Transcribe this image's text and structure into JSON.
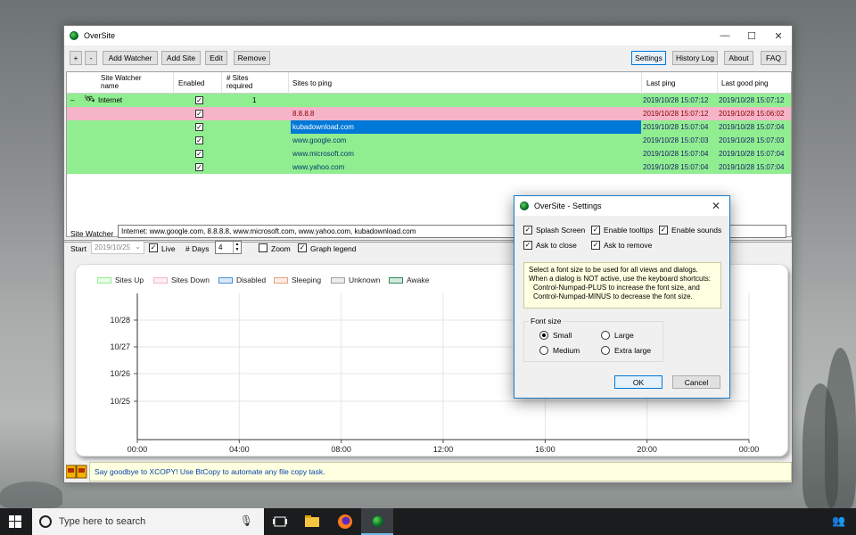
{
  "main_window": {
    "title": "OverSite",
    "controls": {
      "minimize": "—",
      "maximize": "☐",
      "close": "✕"
    }
  },
  "toolbar": {
    "plus": "+",
    "minus": "-",
    "add_watcher": "Add Watcher",
    "add_site": "Add Site",
    "edit": "Edit",
    "remove": "Remove",
    "settings": "Settings",
    "history_log": "History Log",
    "about": "About",
    "faq": "FAQ"
  },
  "grid": {
    "columns": [
      "Site Watcher name",
      "Enabled",
      "# Sites required",
      "Sites to ping",
      "Last ping",
      "Last good ping"
    ],
    "watcher": {
      "expander": "–",
      "name": "Internet",
      "required": "1",
      "last_ping": "2019/10/28 15:07:12",
      "last_good_ping": "2019/10/28 15:07:12"
    },
    "sites": [
      {
        "name": "8.8.8.8",
        "status": "down",
        "last_ping": "2019/10/28 15:07:12",
        "last_good_ping": "2019/10/28 15:06:02"
      },
      {
        "name": "kubadownload.com",
        "status": "up",
        "selected": true,
        "last_ping": "2019/10/28 15:07:04",
        "last_good_ping": "2019/10/28 15:07:04"
      },
      {
        "name": "www.google.com",
        "status": "up",
        "last_ping": "2019/10/28 15:07:03",
        "last_good_ping": "2019/10/28 15:07:03"
      },
      {
        "name": "www.microsoft.com",
        "status": "up",
        "last_ping": "2019/10/28 15:07:04",
        "last_good_ping": "2019/10/28 15:07:04"
      },
      {
        "name": "www.yahoo.com",
        "status": "up",
        "last_ping": "2019/10/28 15:07:04",
        "last_good_ping": "2019/10/28 15:07:04"
      }
    ]
  },
  "watcher_bar": {
    "label": "Site Watcher",
    "value": "Internet: www.google.com, 8.8.8.8, www.microsoft.com, www.yahoo.com, kubadownload.com",
    "start_label": "Start",
    "start_value": "2019/10/25",
    "live_label": "Live",
    "days_label": "# Days",
    "days_value": "4",
    "zoom_label": "Zoom",
    "graph_legend_label": "Graph legend"
  },
  "chart_data": {
    "type": "line",
    "title": "",
    "legend": [
      {
        "name": "Sites Up",
        "color": "#90ee90"
      },
      {
        "name": "Sites Down",
        "color": "#f5b4c8"
      },
      {
        "name": "Disabled",
        "color": "#4a90d9"
      },
      {
        "name": "Sleeping",
        "color": "#e8a080"
      },
      {
        "name": "Unknown",
        "color": "#a0a0a0"
      },
      {
        "name": "Awake",
        "color": "#2e8b57"
      }
    ],
    "x_ticks": [
      "00:00",
      "04:00",
      "08:00",
      "12:00",
      "16:00",
      "20:00",
      "00:00"
    ],
    "y_ticks": [
      "10/28",
      "10/27",
      "10/26",
      "10/25"
    ],
    "series": []
  },
  "tip": {
    "text": "Say goodbye to XCOPY! Use BtCopy to automate any file copy task."
  },
  "settings_dialog": {
    "title": "OverSite - Settings",
    "checks": [
      {
        "label": "Splash Screen",
        "checked": true
      },
      {
        "label": "Enable tooltips",
        "checked": true
      },
      {
        "label": "Enable sounds",
        "checked": true
      },
      {
        "label": "Ask to close",
        "checked": true
      },
      {
        "label": "Ask to remove",
        "checked": true
      }
    ],
    "info_lines": [
      "Select a font size to be used for all views and dialogs.",
      "When a dialog is NOT active, use the keyboard shortcuts:",
      "Control-Numpad-PLUS to increase the font size, and",
      "Control-Numpad-MINUS to decrease the font size."
    ],
    "font_size": {
      "title": "Font size",
      "options": [
        "Small",
        "Large",
        "Medium",
        "Extra large"
      ],
      "selected": "Small"
    },
    "ok": "OK",
    "cancel": "Cancel"
  },
  "taskbar": {
    "search_placeholder": "Type here to search"
  }
}
